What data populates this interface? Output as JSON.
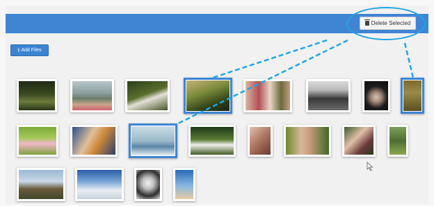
{
  "toolbar": {
    "delete_label": "Delete Selected",
    "delete_icon": "trash-icon",
    "add_label": "Add Files",
    "add_icon": "upload-icon"
  },
  "colors": {
    "topbar": "#3f85d4",
    "selection": "#3c85d4",
    "callout": "#1fa6e4"
  },
  "gallery": {
    "photos": [
      {
        "selected": false
      },
      {
        "selected": false
      },
      {
        "selected": false
      },
      {
        "selected": true
      },
      {
        "selected": false
      },
      {
        "selected": false
      },
      {
        "selected": false
      },
      {
        "selected": true
      },
      {
        "selected": false
      },
      {
        "selected": false
      },
      {
        "selected": true
      },
      {
        "selected": false
      },
      {
        "selected": false
      },
      {
        "selected": false
      },
      {
        "selected": false
      },
      {
        "selected": false
      },
      {
        "selected": false
      },
      {
        "selected": false
      },
      {
        "selected": false
      },
      {
        "selected": false
      }
    ]
  }
}
